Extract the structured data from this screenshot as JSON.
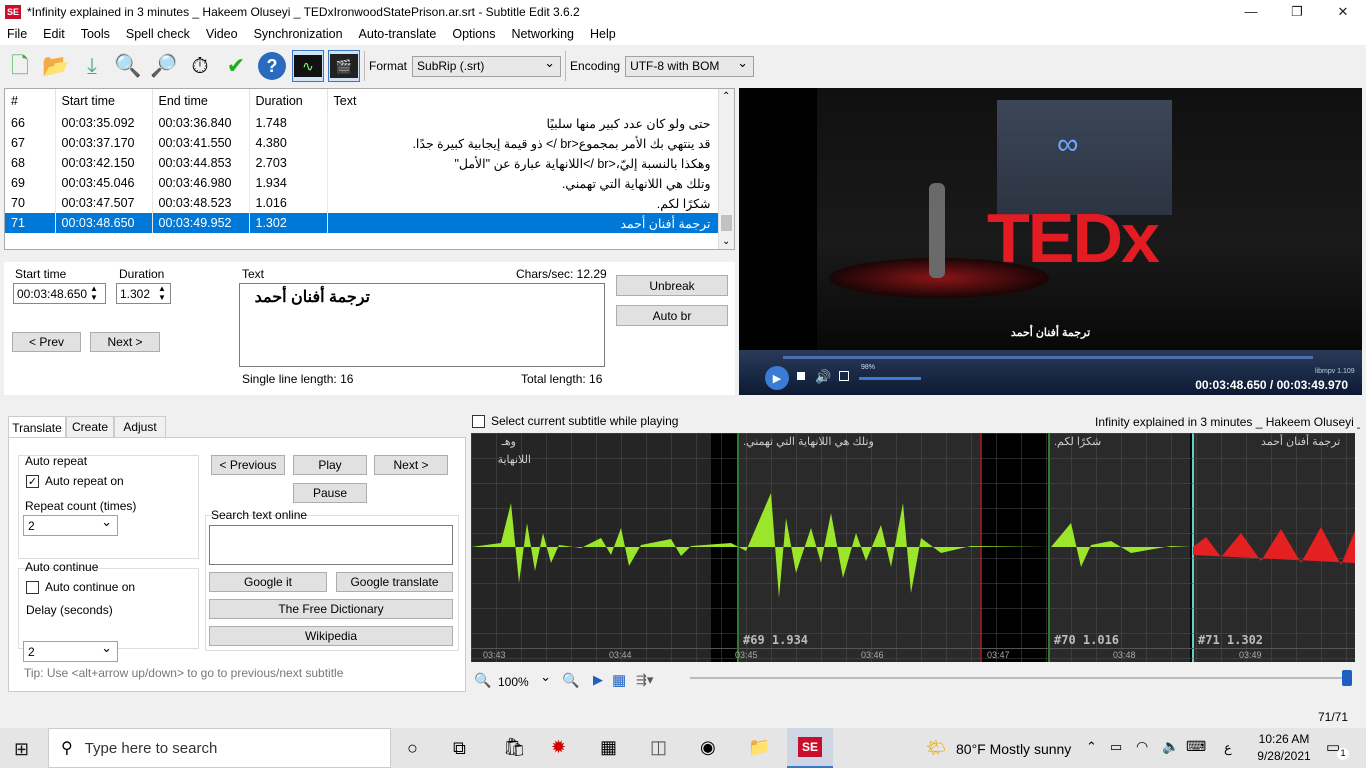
{
  "window": {
    "title": "*Infinity explained in 3 minutes _ Hakeem Oluseyi _ TEDxIronwoodStatePrison.ar.srt - Subtitle Edit 3.6.2",
    "app_icon_text": "SE"
  },
  "menu": [
    "File",
    "Edit",
    "Tools",
    "Spell check",
    "Video",
    "Synchronization",
    "Auto-translate",
    "Options",
    "Networking",
    "Help"
  ],
  "toolbar": {
    "format_label": "Format",
    "format_value": "SubRip (.srt)",
    "encoding_label": "Encoding",
    "encoding_value": "UTF-8 with BOM"
  },
  "grid": {
    "columns": [
      "#",
      "Start time",
      "End time",
      "Duration",
      "Text"
    ],
    "rows": [
      {
        "n": "66",
        "start": "00:03:35.092",
        "end": "00:03:36.840",
        "dur": "1.748",
        "text": "حتى ولو كان عدد كبير منها سلبيًا"
      },
      {
        "n": "67",
        "start": "00:03:37.170",
        "end": "00:03:41.550",
        "dur": "4.380",
        "text": "قد ينتهي بك الأمر بمجموع<br /> ذو قيمة إيجابية كبيرة جدًا."
      },
      {
        "n": "68",
        "start": "00:03:42.150",
        "end": "00:03:44.853",
        "dur": "2.703",
        "text": "وهكذا بالنسبة إليّ،<br />اللانهاية عبارة عن \"الأمل\""
      },
      {
        "n": "69",
        "start": "00:03:45.046",
        "end": "00:03:46.980",
        "dur": "1.934",
        "text": "وتلك هي اللانهاية التي تهمني."
      },
      {
        "n": "70",
        "start": "00:03:47.507",
        "end": "00:03:48.523",
        "dur": "1.016",
        "text": "شكرًا لكم."
      },
      {
        "n": "71",
        "start": "00:03:48.650",
        "end": "00:03:49.952",
        "dur": "1.302",
        "text": "ترجمة أفنان أحمد"
      }
    ]
  },
  "edit": {
    "start_label": "Start time",
    "start_value": "00:03:48.650",
    "duration_label": "Duration",
    "duration_value": "1.302",
    "text_label": "Text",
    "chars_sec": "Chars/sec: 12.29",
    "text_value": "ترجمة أفنان أحمد",
    "prev": "< Prev",
    "next": "Next >",
    "unbreak": "Unbreak",
    "autobr": "Auto br",
    "single_line": "Single line length: 16",
    "total_length": "Total length: 16"
  },
  "video": {
    "subtitle": "ترجمة أفنان أحمد",
    "time": "00:03:48.650 / 00:03:49.970",
    "volume": "98%",
    "player": "libmpv 1.109",
    "stage_text": "TEDx"
  },
  "tabs": [
    "Translate",
    "Create",
    "Adjust"
  ],
  "translate": {
    "auto_repeat_group": "Auto repeat",
    "auto_repeat_on": "Auto repeat on",
    "repeat_count_label": "Repeat count (times)",
    "repeat_count": "2",
    "auto_continue_group": "Auto continue",
    "auto_continue_on": "Auto continue on",
    "delay_label": "Delay (seconds)",
    "delay": "2",
    "previous": "< Previous",
    "play": "Play",
    "next": "Next >",
    "pause": "Pause",
    "search_label": "Search text online",
    "google_it": "Google it",
    "google_translate": "Google translate",
    "free_dictionary": "The Free Dictionary",
    "wikipedia": "Wikipedia",
    "tip": "Tip: Use <alt+arrow up/down> to go to previous/next subtitle"
  },
  "waveform": {
    "select_label": "Select current subtitle while playing",
    "video_name": "Infinity explained in 3 minutes _ Hakeem Oluseyi _",
    "zoom": "100%",
    "seg_labels": [
      "#69  1.934",
      "#70  1.016",
      "#71  1.302"
    ],
    "seg_texts": [
      "وتلك هي اللانهاية التي تهمني.",
      "شكرًا لكم.",
      "ترجمة أفنان أحمد",
      "وهـ",
      "اللانهاية"
    ],
    "ticks": [
      "03:43",
      "03:44",
      "03:45",
      "03:46",
      "03:47",
      "03:48",
      "03:49"
    ]
  },
  "status": {
    "position": "71/71"
  },
  "taskbar": {
    "search": "Type here to search",
    "weather": "80°F  Mostly sunny",
    "time": "10:26 AM",
    "date": "9/28/2021",
    "lang": "ع",
    "notif": "1"
  }
}
